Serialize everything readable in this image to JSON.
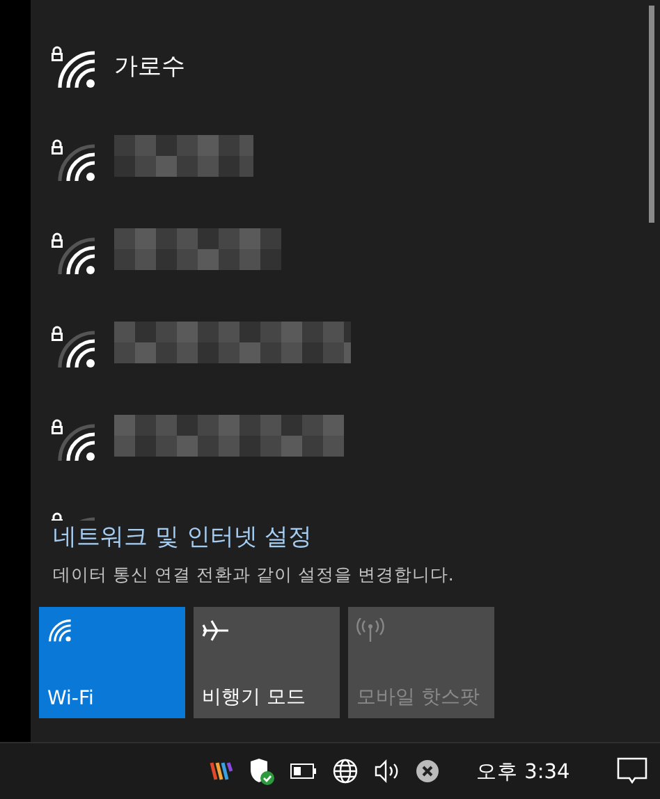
{
  "networks": [
    {
      "kind": "named",
      "name": "가로수",
      "secured": true
    },
    {
      "kind": "redacted",
      "secured": true
    },
    {
      "kind": "redacted",
      "secured": true
    },
    {
      "kind": "redacted",
      "secured": true
    },
    {
      "kind": "redacted",
      "secured": true
    },
    {
      "kind": "cut_off",
      "secured": true
    }
  ],
  "settings": {
    "link": "네트워크 및 인터넷 설정",
    "description": "데이터 통신 연결 전환과 같이 설정을 변경합니다."
  },
  "quick_actions": [
    {
      "kind": "wifi",
      "label": "Wi-Fi",
      "on": true,
      "disabled": false
    },
    {
      "kind": "airplane",
      "label": "비행기 모드",
      "on": false,
      "disabled": false
    },
    {
      "kind": "hotspot",
      "label": "모바일 핫스팟",
      "on": false,
      "disabled": true
    }
  ],
  "taskbar": {
    "clock": "오후 3:34"
  }
}
